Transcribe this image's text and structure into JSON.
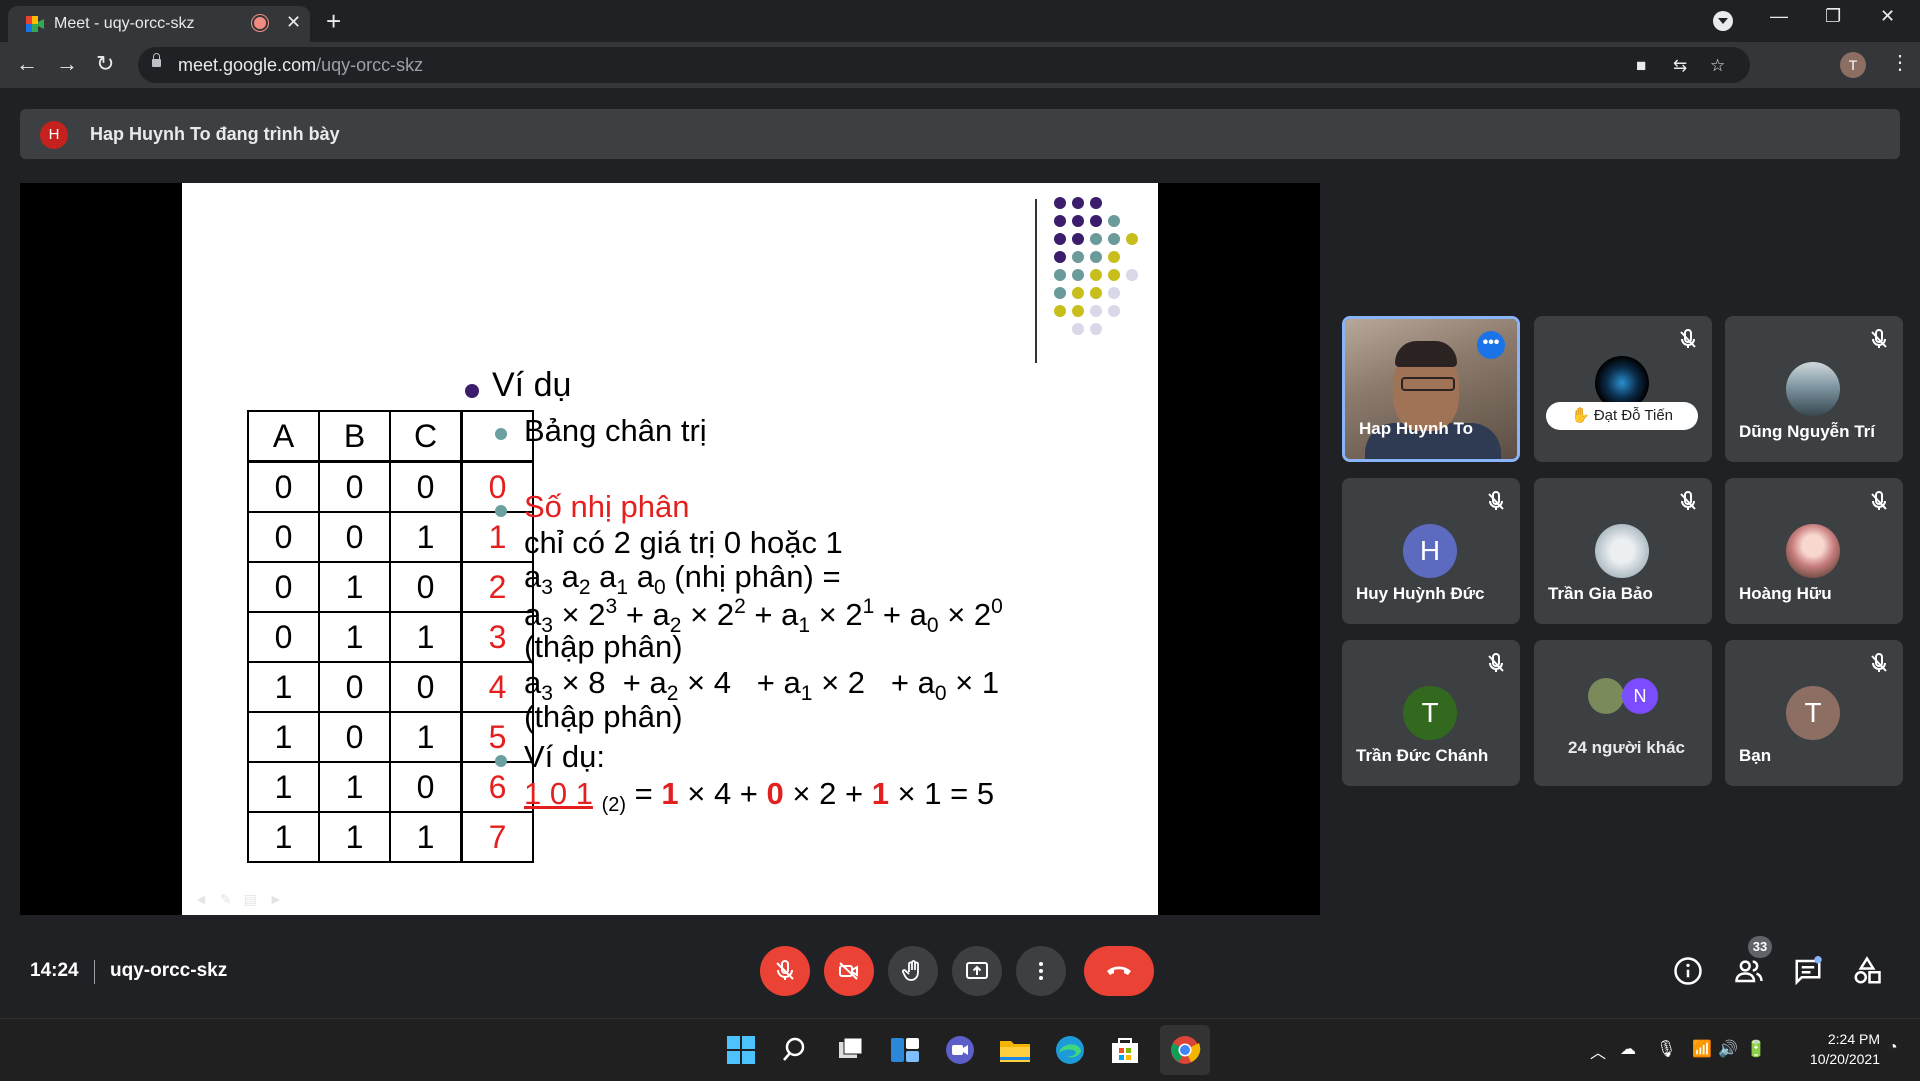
{
  "browser": {
    "tab_title": "Meet - uqy-orcc-skz",
    "url_host": "meet.google.com",
    "url_path": "/uqy-orcc-skz",
    "profile_initial": "T"
  },
  "banner": {
    "avatar_initial": "H",
    "text": "Hap Huynh To đang trình bày"
  },
  "slide": {
    "table": {
      "headers": [
        "A",
        "B",
        "C",
        ""
      ],
      "rows": [
        [
          "0",
          "0",
          "0",
          "0"
        ],
        [
          "0",
          "0",
          "1",
          "1"
        ],
        [
          "0",
          "1",
          "0",
          "2"
        ],
        [
          "0",
          "1",
          "1",
          "3"
        ],
        [
          "1",
          "0",
          "0",
          "4"
        ],
        [
          "1",
          "0",
          "1",
          "5"
        ],
        [
          "1",
          "1",
          "0",
          "6"
        ],
        [
          "1",
          "1",
          "1",
          "7"
        ]
      ]
    },
    "heading": "Ví dụ",
    "bullet1": "Bảng chân trị",
    "bullet2_title": "Số nhị phân",
    "line_values": "chỉ có 2 giá trị 0 hoặc 1",
    "line_a": "a",
    "label_binary": "(nhị phân) =",
    "label_decimal": "(thập phân)",
    "bullet3": "Ví dụ:",
    "example_digits": "1 0 1",
    "example_base": "(2)",
    "example_result": "= 5",
    "colors": {
      "accent_red": "#e31f1f",
      "bullet_purple": "#3b1d6b",
      "bullet_teal": "#6aa0a0"
    }
  },
  "participants": [
    {
      "name": "Hap Huynh To",
      "type": "video",
      "active": true
    },
    {
      "name": "Đạt Đỗ Tiến",
      "type": "avatar-image",
      "hand_raised": true,
      "muted": true
    },
    {
      "name": "Dũng Nguyễn Trí",
      "type": "avatar-image",
      "muted": true
    },
    {
      "name": "Huy Huỳnh Đức",
      "initial": "H",
      "color": "#5c6bc0",
      "muted": true
    },
    {
      "name": "Trần Gia Bảo",
      "type": "avatar-image",
      "muted": true
    },
    {
      "name": "Hoàng Hữu",
      "type": "avatar-image",
      "muted": true
    },
    {
      "name": "Trần Đức Chánh",
      "initial": "T",
      "color": "#33691e",
      "muted": true
    },
    {
      "name": "24 người khác",
      "initial": "N",
      "color": "#7c4dff"
    },
    {
      "name": "Bạn",
      "initial": "T",
      "color": "#8d6e63",
      "muted": true
    }
  ],
  "bottom_bar": {
    "time": "14:24",
    "meeting_code": "uqy-orcc-skz",
    "people_count": "33"
  },
  "taskbar": {
    "time": "2:24 PM",
    "date": "10/20/2021"
  }
}
